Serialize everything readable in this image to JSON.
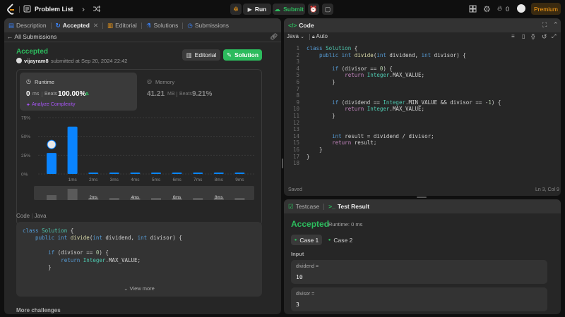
{
  "app": {
    "title": "Problem List",
    "run_label": "Run",
    "submit_label": "Submit",
    "streak_count": "0",
    "premium_label": "Premium"
  },
  "left_tabs": [
    {
      "label": "Description"
    },
    {
      "label": "Accepted"
    },
    {
      "label": "Editorial"
    },
    {
      "label": "Solutions"
    },
    {
      "label": "Submissions"
    }
  ],
  "submission": {
    "back_label": "All Submissions",
    "status": "Accepted",
    "user": "vijayram8",
    "submitted_text": "submitted at Sep 20, 2024 22:42",
    "editorial_label": "Editorial",
    "solution_label": "Solution",
    "runtime_title": "Runtime",
    "runtime_value": "0",
    "runtime_unit": "ms",
    "beats_label": "Beats",
    "runtime_beats": "100.00%",
    "analyze_label": "Analyze Complexity",
    "memory_title": "Memory",
    "memory_value": "41.21",
    "memory_unit": "MB",
    "memory_beats": "9.21%"
  },
  "chart_data": {
    "type": "bar",
    "yticks": [
      "75%",
      "50%",
      "25%",
      "0%"
    ],
    "ylim": [
      0,
      75
    ],
    "categories": [
      "",
      "1ms",
      "2ms",
      "3ms",
      "4ms",
      "5ms",
      "6ms",
      "7ms",
      "8ms",
      "9ms"
    ],
    "values": [
      28,
      63,
      2,
      2,
      2,
      2,
      2,
      2,
      2,
      2
    ],
    "mini_values": [
      7,
      16,
      3,
      3,
      3,
      3,
      3,
      3,
      3,
      3
    ],
    "mini_labels": [
      "",
      "",
      "2ms",
      "",
      "4ms",
      "",
      "6ms",
      "",
      "8ms",
      ""
    ],
    "bar_color": "#0a84ff"
  },
  "code_card": {
    "lang_label": "Code",
    "lang": "Java",
    "view_more": "View more"
  },
  "preview_lines": [
    [
      {
        "t": "class ",
        "c": "kw"
      },
      {
        "t": "Solution ",
        "c": "ty"
      },
      {
        "t": "{",
        "c": "pl"
      }
    ],
    [
      {
        "t": "    public ",
        "c": "kw"
      },
      {
        "t": "int ",
        "c": "kw"
      },
      {
        "t": "divide",
        "c": "fn"
      },
      {
        "t": "(",
        "c": "pl"
      },
      {
        "t": "int ",
        "c": "kw"
      },
      {
        "t": "dividend, ",
        "c": "pl"
      },
      {
        "t": "int ",
        "c": "kw"
      },
      {
        "t": "divisor) {",
        "c": "pl"
      }
    ],
    [],
    [
      {
        "t": "        if ",
        "c": "kw"
      },
      {
        "t": "(divisor == ",
        "c": "pl"
      },
      {
        "t": "0",
        "c": "nm"
      },
      {
        "t": ") {",
        "c": "pl"
      }
    ],
    [
      {
        "t": "            return ",
        "c": "kw"
      },
      {
        "t": "Integer",
        "c": "ty"
      },
      {
        "t": ".MAX_VALUE;",
        "c": "pl"
      }
    ],
    [
      {
        "t": "        }",
        "c": "pl"
      }
    ]
  ],
  "more_challenges": "More challenges",
  "editor": {
    "title": "Code",
    "lang": "Java",
    "auto_label": "Auto",
    "saved_label": "Saved",
    "cursor_pos": "Ln 3, Col 9",
    "lines": [
      [
        {
          "t": "class ",
          "c": "kw"
        },
        {
          "t": "Solution ",
          "c": "ty"
        },
        {
          "t": "{",
          "c": "pl"
        }
      ],
      [
        {
          "t": "    public ",
          "c": "kw"
        },
        {
          "t": "int ",
          "c": "kw"
        },
        {
          "t": "divide",
          "c": "fn"
        },
        {
          "t": "(",
          "c": "pl"
        },
        {
          "t": "int ",
          "c": "kw"
        },
        {
          "t": "dividend, ",
          "c": "pl"
        },
        {
          "t": "int ",
          "c": "kw"
        },
        {
          "t": "divisor) {",
          "c": "pl"
        }
      ],
      [],
      [
        {
          "t": "        if ",
          "c": "kw"
        },
        {
          "t": "(divisor == ",
          "c": "pl"
        },
        {
          "t": "0",
          "c": "nm"
        },
        {
          "t": ") {",
          "c": "pl"
        }
      ],
      [
        {
          "t": "            return ",
          "c": "st"
        },
        {
          "t": "Integer",
          "c": "ty"
        },
        {
          "t": ".MAX_VALUE;",
          "c": "pl"
        }
      ],
      [
        {
          "t": "        }",
          "c": "pl"
        }
      ],
      [],
      [],
      [
        {
          "t": "        if ",
          "c": "kw"
        },
        {
          "t": "(dividend == ",
          "c": "pl"
        },
        {
          "t": "Integer",
          "c": "ty"
        },
        {
          "t": ".MIN_VALUE && divisor == -",
          "c": "pl"
        },
        {
          "t": "1",
          "c": "nm"
        },
        {
          "t": ") {",
          "c": "pl"
        }
      ],
      [
        {
          "t": "            return ",
          "c": "st"
        },
        {
          "t": "Integer",
          "c": "ty"
        },
        {
          "t": ".MAX_VALUE;",
          "c": "pl"
        }
      ],
      [
        {
          "t": "        }",
          "c": "pl"
        }
      ],
      [],
      [],
      [
        {
          "t": "        int ",
          "c": "kw"
        },
        {
          "t": "result = dividend / divisor;",
          "c": "pl"
        }
      ],
      [
        {
          "t": "        return ",
          "c": "st"
        },
        {
          "t": "result;",
          "c": "pl"
        }
      ],
      [
        {
          "t": "    }",
          "c": "pl"
        }
      ],
      [
        {
          "t": "}",
          "c": "pl"
        }
      ],
      []
    ]
  },
  "result_panel": {
    "testcase_tab": "Testcase",
    "result_tab": "Test Result",
    "status": "Accepted",
    "runtime": "Runtime: 0 ms",
    "case1": "Case 1",
    "case2": "Case 2",
    "input_label": "Input",
    "param1_name": "dividend =",
    "param1_value": "10",
    "param2_name": "divisor =",
    "param2_value": "3"
  }
}
